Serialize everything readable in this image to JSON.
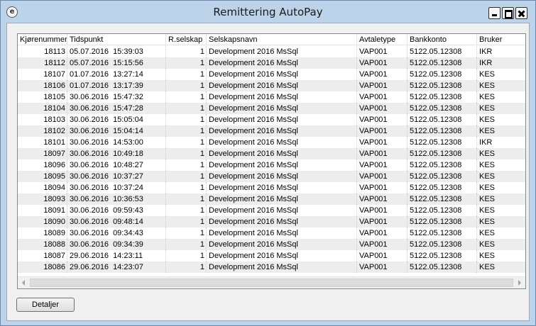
{
  "window": {
    "title": "Remittering AutoPay",
    "icon": "app-e-icon"
  },
  "table": {
    "columns": [
      "Kjørenummer",
      "Tidspunkt",
      "R.selskap",
      "Selskapsnavn",
      "Avtaletype",
      "Bankkonto",
      "Bruker"
    ],
    "rows": [
      {
        "kjorenummer": "18113",
        "dato": "05.07.2016",
        "tid": "15:39:03",
        "rselskap": "1",
        "selskapsnavn": "Development 2016 MsSql",
        "avtaletype": "VAP001",
        "bankkonto": "5122.05.12308",
        "bruker": "IKR"
      },
      {
        "kjorenummer": "18112",
        "dato": "05.07.2016",
        "tid": "15:15:56",
        "rselskap": "1",
        "selskapsnavn": "Development 2016 MsSql",
        "avtaletype": "VAP001",
        "bankkonto": "5122.05.12308",
        "bruker": "IKR"
      },
      {
        "kjorenummer": "18107",
        "dato": "01.07.2016",
        "tid": "13:27:14",
        "rselskap": "1",
        "selskapsnavn": "Development 2016 MsSql",
        "avtaletype": "VAP001",
        "bankkonto": "5122.05.12308",
        "bruker": "KES"
      },
      {
        "kjorenummer": "18106",
        "dato": "01.07.2016",
        "tid": "13:17:39",
        "rselskap": "1",
        "selskapsnavn": "Development 2016 MsSql",
        "avtaletype": "VAP001",
        "bankkonto": "5122.05.12308",
        "bruker": "KES"
      },
      {
        "kjorenummer": "18105",
        "dato": "30.06.2016",
        "tid": "15:47:32",
        "rselskap": "1",
        "selskapsnavn": "Development 2016 MsSql",
        "avtaletype": "VAP001",
        "bankkonto": "5122.05.12308",
        "bruker": "KES"
      },
      {
        "kjorenummer": "18104",
        "dato": "30.06.2016",
        "tid": "15:47:28",
        "rselskap": "1",
        "selskapsnavn": "Development 2016 MsSql",
        "avtaletype": "VAP001",
        "bankkonto": "5122.05.12308",
        "bruker": "KES"
      },
      {
        "kjorenummer": "18103",
        "dato": "30.06.2016",
        "tid": "15:05:04",
        "rselskap": "1",
        "selskapsnavn": "Development 2016 MsSql",
        "avtaletype": "VAP001",
        "bankkonto": "5122.05.12308",
        "bruker": "KES"
      },
      {
        "kjorenummer": "18102",
        "dato": "30.06.2016",
        "tid": "15:04:14",
        "rselskap": "1",
        "selskapsnavn": "Development 2016 MsSql",
        "avtaletype": "VAP001",
        "bankkonto": "5122.05.12308",
        "bruker": "KES"
      },
      {
        "kjorenummer": "18101",
        "dato": "30.06.2016",
        "tid": "14:53:00",
        "rselskap": "1",
        "selskapsnavn": "Development 2016 MsSql",
        "avtaletype": "VAP001",
        "bankkonto": "5122.05.12308",
        "bruker": "IKR"
      },
      {
        "kjorenummer": "18097",
        "dato": "30.06.2016",
        "tid": "10:49:18",
        "rselskap": "1",
        "selskapsnavn": "Development 2016 MsSql",
        "avtaletype": "VAP001",
        "bankkonto": "5122.05.12308",
        "bruker": "KES"
      },
      {
        "kjorenummer": "18096",
        "dato": "30.06.2016",
        "tid": "10:48:27",
        "rselskap": "1",
        "selskapsnavn": "Development 2016 MsSql",
        "avtaletype": "VAP001",
        "bankkonto": "5122.05.12308",
        "bruker": "KES"
      },
      {
        "kjorenummer": "18095",
        "dato": "30.06.2016",
        "tid": "10:37:27",
        "rselskap": "1",
        "selskapsnavn": "Development 2016 MsSql",
        "avtaletype": "VAP001",
        "bankkonto": "5122.05.12308",
        "bruker": "KES"
      },
      {
        "kjorenummer": "18094",
        "dato": "30.06.2016",
        "tid": "10:37:24",
        "rselskap": "1",
        "selskapsnavn": "Development 2016 MsSql",
        "avtaletype": "VAP001",
        "bankkonto": "5122.05.12308",
        "bruker": "KES"
      },
      {
        "kjorenummer": "18093",
        "dato": "30.06.2016",
        "tid": "10:36:53",
        "rselskap": "1",
        "selskapsnavn": "Development 2016 MsSql",
        "avtaletype": "VAP001",
        "bankkonto": "5122.05.12308",
        "bruker": "KES"
      },
      {
        "kjorenummer": "18091",
        "dato": "30.06.2016",
        "tid": "09:59:43",
        "rselskap": "1",
        "selskapsnavn": "Development 2016 MsSql",
        "avtaletype": "VAP001",
        "bankkonto": "5122.05.12308",
        "bruker": "KES"
      },
      {
        "kjorenummer": "18090",
        "dato": "30.06.2016",
        "tid": "09:48:14",
        "rselskap": "1",
        "selskapsnavn": "Development 2016 MsSql",
        "avtaletype": "VAP001",
        "bankkonto": "5122.05.12308",
        "bruker": "KES"
      },
      {
        "kjorenummer": "18089",
        "dato": "30.06.2016",
        "tid": "09:34:43",
        "rselskap": "1",
        "selskapsnavn": "Development 2016 MsSql",
        "avtaletype": "VAP001",
        "bankkonto": "5122.05.12308",
        "bruker": "KES"
      },
      {
        "kjorenummer": "18088",
        "dato": "30.06.2016",
        "tid": "09:34:39",
        "rselskap": "1",
        "selskapsnavn": "Development 2016 MsSql",
        "avtaletype": "VAP001",
        "bankkonto": "5122.05.12308",
        "bruker": "KES"
      },
      {
        "kjorenummer": "18087",
        "dato": "29.06.2016",
        "tid": "14:23:11",
        "rselskap": "1",
        "selskapsnavn": "Development 2016 MsSql",
        "avtaletype": "VAP001",
        "bankkonto": "5122.05.12308",
        "bruker": "KES"
      },
      {
        "kjorenummer": "18086",
        "dato": "29.06.2016",
        "tid": "14:23:07",
        "rselskap": "1",
        "selskapsnavn": "Development 2016 MsSql",
        "avtaletype": "VAP001",
        "bankkonto": "5122.05.12308",
        "bruker": "KES"
      }
    ]
  },
  "buttons": {
    "details_label": "Detaljer"
  }
}
